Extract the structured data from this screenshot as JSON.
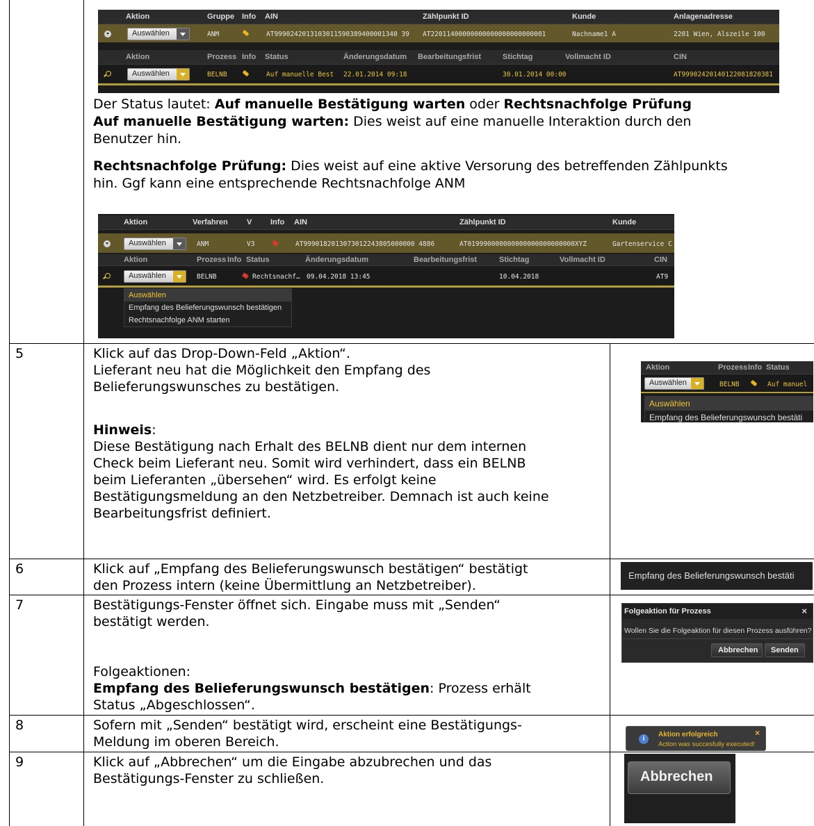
{
  "shot1": {
    "header": [
      "Aktion",
      "Gruppe",
      "Info",
      "AIN",
      "Zählpunkt ID",
      "Kunde",
      "Anlagenadresse"
    ],
    "row": {
      "select": "Auswählen",
      "gruppe": "ANM",
      "ain": "AT9990242013103011590389400001340 39",
      "zp": "AT22011400000000000000000000001",
      "kunde": "Nachname1 A",
      "adresse": "2201 Wien, Alszeile 100"
    },
    "subheader": [
      "Aktion",
      "Prozess",
      "Info",
      "Status",
      "Änderungsdatum",
      "Bearbeitungsfrist",
      "Stichtag",
      "Vollmacht ID",
      "CIN"
    ],
    "subrow": {
      "select": "Auswählen",
      "prozess": "BELNB",
      "status": "Auf manuelle Best",
      "aenderung": "22.01.2014 09:18",
      "stichtag": "30.01.2014 00:00",
      "cin": "AT99902420140122081820381"
    }
  },
  "intro": {
    "l1a": "Der Status lautet: ",
    "l1b": "Auf manuelle Bestätigung warten",
    "l1c": " oder ",
    "l1d": "Rechtsnachfolge Prüfung",
    "l2a": "Auf manuelle Bestätigung warten:",
    "l2b": " Dies weist auf eine manuelle Interaktion durch den",
    "l3": "Benutzer hin.",
    "l4a": "Rechtsnachfolge Prüfung:",
    "l4b": " Dies weist auf eine aktive Versorung des betreffenden Zählpunkts",
    "l5": "hin. Ggf kann eine entsprechende Rechtsnachfolge ANM"
  },
  "shot2": {
    "header": [
      "Aktion",
      "Verfahren",
      "V",
      "Info",
      "AIN",
      "Zählpunkt ID",
      "Kunde"
    ],
    "row": {
      "select": "Auswählen",
      "verfahren": "ANM",
      "v": "V3",
      "ain": "AT9990182013073012243805000000 4886",
      "zp": "AT019990000000000000000000000XYZ",
      "kunde": "Gartenservice C"
    },
    "subheader": [
      "Aktion",
      "Prozess",
      "Info",
      "Status",
      "Änderungsdatum",
      "Bearbeitungsfrist",
      "Stichtag",
      "Vollmacht ID",
      "CIN"
    ],
    "subrow": {
      "select": "Auswählen",
      "prozess": "BELNB",
      "status": "Rechtsnachf…",
      "aenderung": "09.04.2018 13:45",
      "stichtag": "10.04.2018",
      "cin": "AT9"
    },
    "menu": [
      "Auswählen",
      "Empfang des Belieferungswunsch bestätigen",
      "Rechtsnachfolge ANM starten"
    ]
  },
  "steps": [
    {
      "num": "5",
      "lines": [
        "Klick auf das Drop-Down-Feld „Aktion“.",
        "Lieferant neu hat die Möglichkeit den Empfang des",
        "Belieferungswunsches zu bestätigen."
      ],
      "hint_title": "Hinweis",
      "hint_colon": ":",
      "hint_lines": [
        "Diese Bestätigung nach Erhalt des BELNB dient nur dem internen",
        "Check beim Lieferant neu. Somit wird verhindert, dass ein BELNB",
        "beim Lieferanten „übersehen“ wird. Es erfolgt keine",
        "Bestätigungsmeldung an den Netzbetreiber. Demnach ist auch keine",
        "Bearbeitungsfrist definiert."
      ]
    },
    {
      "num": "6",
      "lines": [
        "Klick auf „Empfang des Belieferungswunsch bestätigen“ bestätigt",
        "den Prozess intern (keine Übermittlung an Netzbetreiber)."
      ]
    },
    {
      "num": "7",
      "lines": [
        "Bestätigungs-Fenster öffnet sich. Eingabe muss mit „Senden“",
        "bestätigt werden."
      ],
      "follow_title": "Folgeaktionen:",
      "follow_bold": "Empfang des Belieferungswunsch bestätigen",
      "follow_rest": ": Prozess erhält",
      "follow_line2": "Status „Abgeschlossen“."
    },
    {
      "num": "8",
      "lines": [
        "Sofern mit „Senden“ bestätigt wird, erscheint eine Bestätigungs-",
        "Meldung im oberen Bereich."
      ]
    },
    {
      "num": "9",
      "lines": [
        "Klick auf „Abbrechen“ um die Eingabe abzubrechen und das",
        "Bestätigungs-Fenster zu schließen."
      ]
    }
  ],
  "thumbs": {
    "t5": {
      "header": [
        "Aktion",
        "Prozess",
        "Info",
        "Status"
      ],
      "select": "Auswählen",
      "prozess": "BELNB",
      "status": "Auf manuel",
      "menu": [
        "Auswählen",
        "Empfang des Belieferungswunsch bestäti"
      ]
    },
    "t6": {
      "label": "Empfang des Belieferungswunsch bestäti"
    },
    "t7": {
      "title": "Folgeaktion für Prozess",
      "close": "×",
      "question": "Wollen Sie die Folgeaktion für diesen Prozess ausführen?",
      "cancel": "Abbrechen",
      "send": "Senden"
    },
    "t8": {
      "title": "Aktion erfolgreich",
      "msg": "Action was succesfully executed!",
      "close": "×"
    },
    "t9": {
      "label": "Abbrechen"
    }
  }
}
